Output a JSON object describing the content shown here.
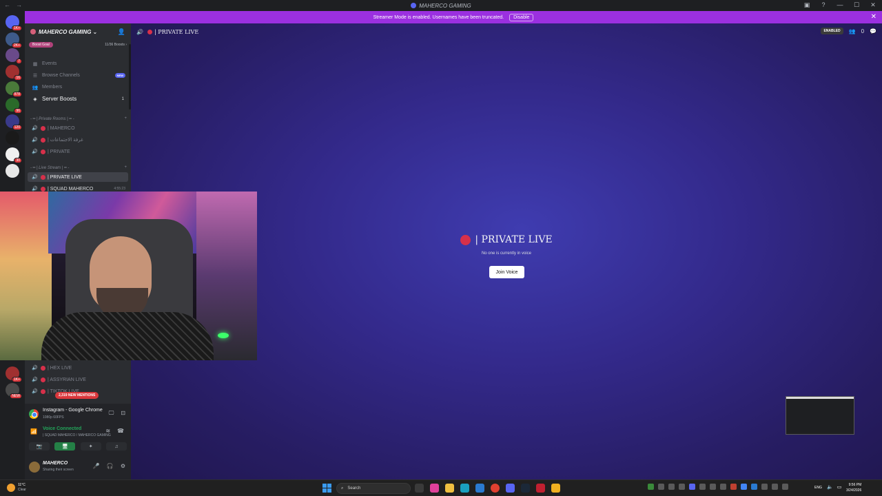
{
  "window": {
    "title": "MAHERCO GAMING",
    "nav_back": "←",
    "nav_fwd": "→",
    "controls": [
      "▣",
      "?",
      "—",
      "☐",
      "✕"
    ]
  },
  "banner": {
    "message": "Streamer Mode is enabled. Usernames have been truncated.",
    "disable_label": "Disable",
    "close": "✕"
  },
  "rail": {
    "badges": [
      "1K+",
      "2K+",
      "7",
      "16",
      "878",
      "96",
      "120",
      "30",
      "1K+",
      "NEW"
    ]
  },
  "sidebar": {
    "server_name": "MAHERCO GAMING",
    "server_chevron": "⌄",
    "boost_goal": "Boost Goal",
    "boost_count": "11/36 Boosts ›",
    "items": [
      {
        "icon": "▦",
        "label": "Events"
      },
      {
        "icon": "☰",
        "label": "Browse Channels",
        "badge": "NEW"
      },
      {
        "icon": "👥",
        "label": "Members"
      },
      {
        "icon": "◈",
        "label": "Server Boosts",
        "count": "1"
      }
    ],
    "category_private": "- ━ | Private Rooms | ━ -",
    "private_channels": [
      "| MAHERCO",
      "| غرفة الاجتماعات",
      "| PRIVATE"
    ],
    "category_live": "- ━ | Live Stream | ━ -",
    "live_channels": [
      {
        "label": "| PRIVATE LIVE",
        "selected": true,
        "timer": ""
      },
      {
        "label": "| SQUAD MAHERCO",
        "selected": false,
        "timer": "4:55:23"
      }
    ],
    "lower_channels": [
      "| HEX LIVE",
      "| ASSYRIAN LIVE",
      "| TIKTOK LIVE"
    ],
    "mentions": "2,319 NEW MENTIONS",
    "plus": "+"
  },
  "panel": {
    "stream_title": "Instagram - Google Chrome",
    "stream_quality": "1080p 60FPS",
    "voice_status": "Voice Connected",
    "voice_channel": "| SQUAD MAHERCO / MAHERCO GAMING",
    "username": "MAHERCO",
    "user_status": "Sharing their screen"
  },
  "main": {
    "channel_name": "| PRIVATE LIVE",
    "enabled_label": "ENABLED",
    "member_count": "0",
    "center_title": "| PRIVATE LIVE",
    "center_sub": "No one is currently in voice",
    "join_label": "Join Voice"
  },
  "taskbar": {
    "temp": "11°C",
    "condition": "Clear",
    "search_placeholder": "Search",
    "lang": "ENG",
    "time": "9:56 PM",
    "date": "3/24/2026"
  },
  "colors": {
    "banner": "#9b30e0",
    "live_dot": "#d7304a",
    "voice_green": "#23a55a",
    "mention_red": "#da373c"
  }
}
